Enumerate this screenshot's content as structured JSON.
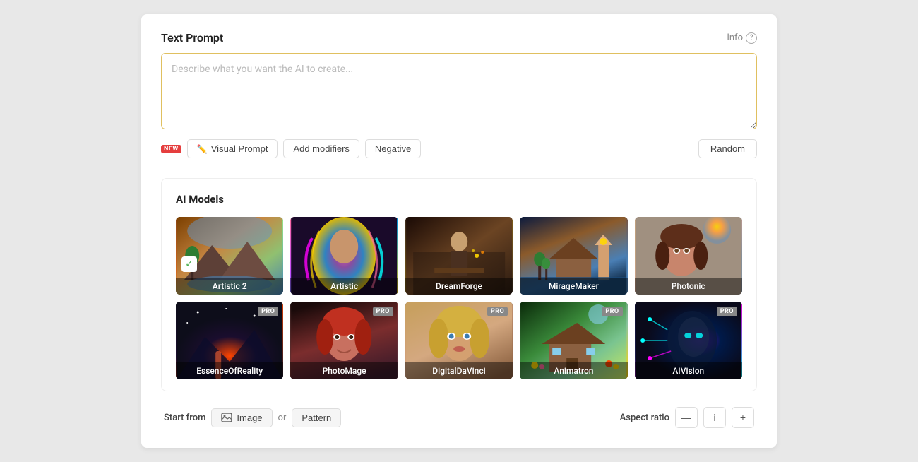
{
  "header": {
    "title": "Text Prompt",
    "info_label": "Info"
  },
  "prompt": {
    "placeholder": "Describe what you want the AI to create...",
    "value": ""
  },
  "toolbar": {
    "new_badge": "NEW",
    "visual_prompt_label": "Visual Prompt",
    "add_modifiers_label": "Add modifiers",
    "negative_label": "Negative",
    "random_label": "Random"
  },
  "ai_models": {
    "section_title": "AI Models",
    "models_row1": [
      {
        "id": "artistic2",
        "label": "Artistic 2",
        "selected": true,
        "pro": false
      },
      {
        "id": "artistic",
        "label": "Artistic",
        "selected": false,
        "pro": false
      },
      {
        "id": "dreamforge",
        "label": "DreamForge",
        "selected": false,
        "pro": false
      },
      {
        "id": "miragemaker",
        "label": "MirageMaker",
        "selected": false,
        "pro": false
      },
      {
        "id": "photonic",
        "label": "Photonic",
        "selected": false,
        "pro": false
      }
    ],
    "models_row2": [
      {
        "id": "essenceofreality",
        "label": "EssenceOfReality",
        "selected": false,
        "pro": true
      },
      {
        "id": "photomage",
        "label": "PhotoMage",
        "selected": false,
        "pro": true
      },
      {
        "id": "digitaldavinci",
        "label": "DigitalDaVinci",
        "selected": false,
        "pro": true
      },
      {
        "id": "animatron",
        "label": "Animatron",
        "selected": false,
        "pro": true
      },
      {
        "id": "aivision",
        "label": "AIVision",
        "selected": false,
        "pro": true
      }
    ]
  },
  "bottom": {
    "start_from_label": "Start from",
    "image_label": "Image",
    "or_label": "or",
    "pattern_label": "Pattern",
    "aspect_ratio_label": "Aspect ratio",
    "minus_label": "—",
    "ratio_label": "i",
    "plus_label": "+"
  }
}
